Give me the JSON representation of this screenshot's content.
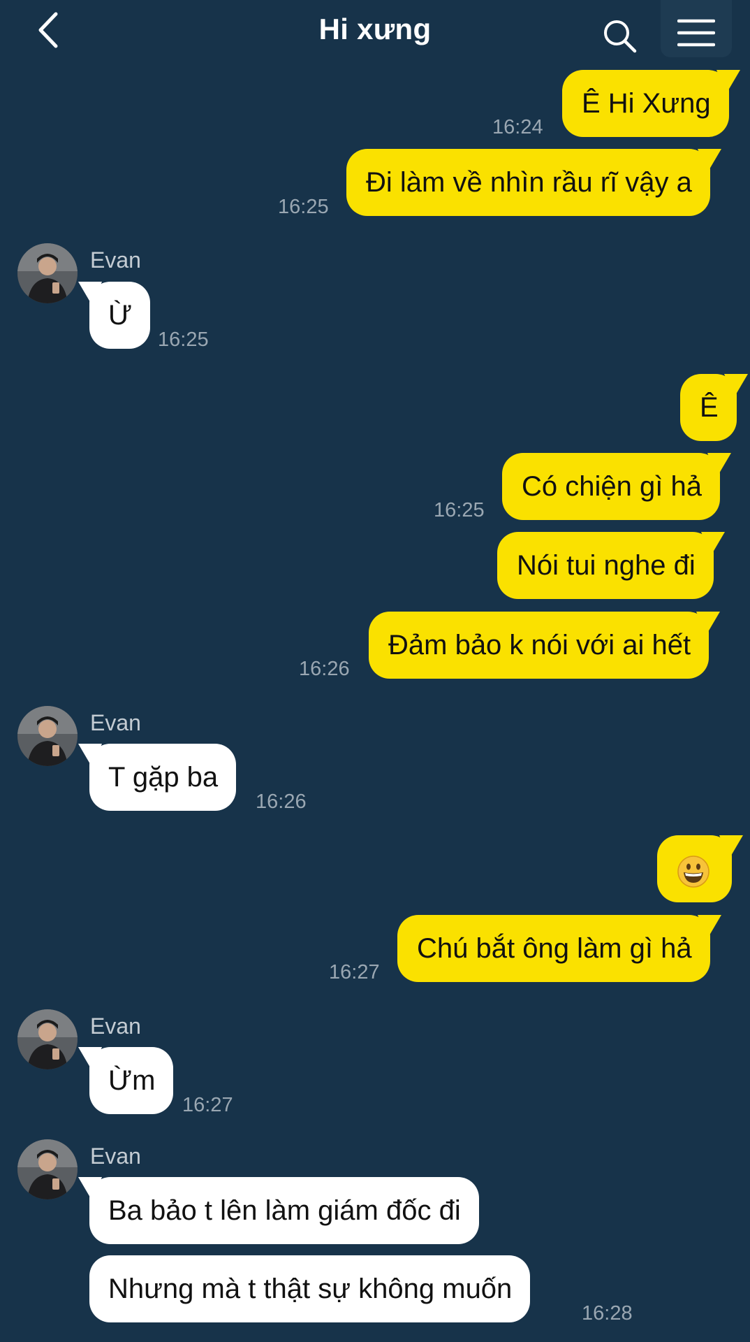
{
  "header": {
    "title": "Hi xưng"
  },
  "icons": {
    "back": "chevron-left-icon",
    "search": "search-icon",
    "menu": "hamburger-menu-icon"
  },
  "colors": {
    "background": "#17334a",
    "outgoing": "#fae100",
    "incoming": "#ffffff",
    "time": "#9aa7b2",
    "sender": "#c4ccd3"
  },
  "messages": [
    {
      "text": "Ê Hi Xưng",
      "time": "16:24"
    },
    {
      "text": "Đi làm về nhìn rầu rĩ vậy a",
      "time": "16:25"
    },
    {
      "sender": "Evan",
      "text": "Ừ",
      "time": "16:25"
    },
    {
      "text": "Ê"
    },
    {
      "text": "Có chiện gì hả",
      "time": "16:25"
    },
    {
      "text": "Nói tui nghe đi"
    },
    {
      "text": "Đảm bảo k nói với ai hết",
      "time": "16:26"
    },
    {
      "sender": "Evan",
      "text": "T gặp ba",
      "time": "16:26"
    },
    {
      "emoji": "grinning-face"
    },
    {
      "text": "Chú bắt ông làm gì hả",
      "time": "16:27"
    },
    {
      "sender": "Evan",
      "text": "Ừm",
      "time": "16:27"
    },
    {
      "sender": "Evan",
      "text": "Ba bảo t lên làm giám đốc đi"
    },
    {
      "text": "Nhưng mà t thật sự không muốn",
      "time": "16:28"
    }
  ]
}
